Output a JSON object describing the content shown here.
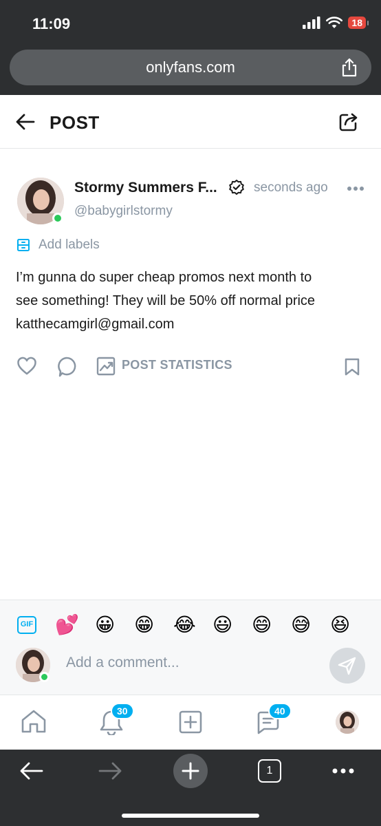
{
  "status_bar": {
    "time": "11:09",
    "battery": "18"
  },
  "browser": {
    "url": "onlyfans.com"
  },
  "header": {
    "title": "POST"
  },
  "post": {
    "author_name": "Stormy Summers F...",
    "time": "seconds ago",
    "handle": "@babygirlstormy",
    "labels_text": "Add labels",
    "body_lines": [
      "I’m gunna do super cheap promos next month to",
      "see something! They will be 50% off normal price",
      "katthecamgirl@gmail.com"
    ],
    "stats_label": "POST STATISTICS"
  },
  "comment": {
    "gif_label": "GIF",
    "emojis": [
      "💕",
      "😀",
      "😁",
      "😂",
      "😃",
      "😄",
      "😅",
      "😆"
    ],
    "placeholder": "Add a comment..."
  },
  "bottom_nav": {
    "notifications_count": "30",
    "messages_count": "40"
  },
  "toolbar": {
    "tabs_count": "1"
  },
  "colors": {
    "accent": "#00aff0",
    "muted": "#8a96a3",
    "online": "#2bc95a",
    "chrome": "#2d2f31"
  }
}
